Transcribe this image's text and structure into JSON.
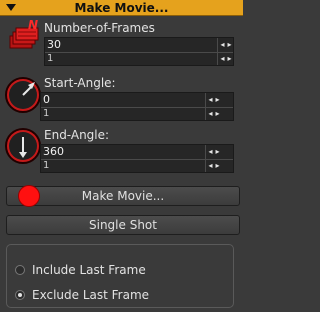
{
  "window": {
    "title": "Make Movie..."
  },
  "params": {
    "frames": {
      "label": "Number-of-Frames",
      "value": "30",
      "step": "1"
    },
    "start": {
      "label": "Start-Angle:",
      "value": "0",
      "step": "1"
    },
    "end": {
      "label": "End-Angle:",
      "value": "360",
      "step": "1"
    }
  },
  "buttons": {
    "make_movie": "Make Movie...",
    "single_shot": "Single Shot"
  },
  "options": {
    "include_last": {
      "label": "Include Last Frame",
      "selected": false
    },
    "exclude_last": {
      "label": "Exclude Last Frame",
      "selected": true
    }
  },
  "spinner": {
    "up": "▲",
    "down": "▼"
  },
  "colors": {
    "title_bar": "#e5a21d",
    "record": "#ff1010",
    "icon_red": "#d81c1c"
  },
  "icons": [
    "collapse-arrow-icon",
    "frames-stack-icon",
    "angle-dial-icon",
    "record-icon"
  ]
}
